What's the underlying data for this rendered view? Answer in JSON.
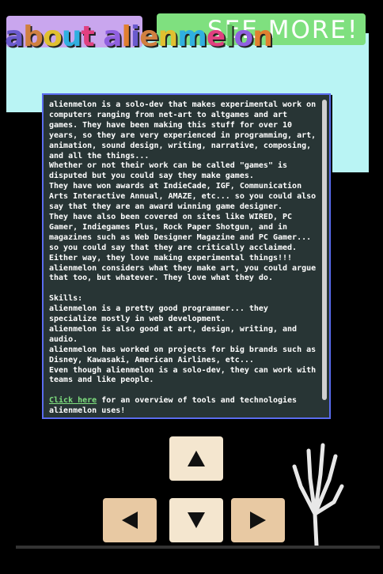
{
  "header": {
    "title": "about alienmelon",
    "see_more": "SEE MORE!"
  },
  "content": {
    "paragraphs": [
      "alienmelon is a solo-dev that makes experimental work on computers ranging from net-art to altgames and art games. They have been making this stuff for over 10 years, so they are very experienced in programming, art, animation, sound design, writing, narrative, composing, and all the things...",
      "Whether or not their work can be called \"games\" is disputed but you could say they make games.",
      "They have won awards at IndieCade, IGF, Communication Arts Interactive Annual, AMAZE, etc... so you could also say that they are an award winning game designer.",
      "They have also been covered on sites like WIRED, PC Gamer, Indiegames Plus, Rock Paper Shotgun, and in magazines such as Web Designer Magazine and PC Gamer... so you could say that they are critically acclaimed.",
      "Either way, they love making experimental things!!!",
      "alienmelon considers what they make art, you could argue that too, but whatever. They love what they do."
    ],
    "skills_heading": "Skills:",
    "skills": [
      "alienmelon is a pretty good programmer... they specialize mostly in web development.",
      "alienmelon is also good at art, design, writing, and audio.",
      "alienmelon has worked on projects for big brands such as Disney, Kawasaki, American Airlines, etc...",
      "Even though alienmelon is a solo-dev, they can work with teams and like people."
    ],
    "link_text": "Click here",
    "link_suffix": " for an overview of tools and technologies alienmelon uses!"
  },
  "colors": {
    "sky": "#b9f4f4",
    "panel": "#283535",
    "border": "#5a6cf0",
    "link": "#7fe07f"
  },
  "keys": {
    "up": "arrow-up-icon",
    "left": "arrow-left-icon",
    "down": "arrow-down-icon",
    "right": "arrow-right-icon"
  }
}
